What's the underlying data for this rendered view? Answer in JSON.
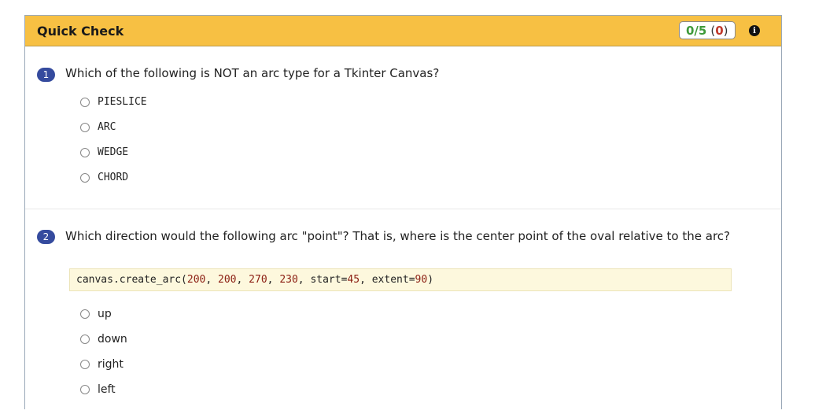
{
  "header": {
    "title": "Quick Check",
    "score": {
      "correct": "0/5",
      "open_paren": "(",
      "wrong": "0",
      "close_paren": ")"
    },
    "info_icon": "info-icon"
  },
  "questions": [
    {
      "number": "1",
      "text": "Which of the following is NOT an arc type for a Tkinter Canvas?",
      "options": [
        "PIESLICE",
        "ARC",
        "WEDGE",
        "CHORD"
      ]
    },
    {
      "number": "2",
      "text": "Which direction would the following arc \"point\"? That is, where is the center point of the oval relative to the arc?",
      "code": {
        "prefix": "canvas.create_arc(",
        "args": [
          "200",
          "200",
          "270",
          "230"
        ],
        "start_kw": "start=",
        "start": "45",
        "extent_kw": "extent=",
        "extent": "90",
        "suffix": ")"
      },
      "options": [
        "up",
        "down",
        "right",
        "left"
      ]
    }
  ],
  "colors": {
    "header_bg": "#f7c043",
    "badge_bg": "#354b9e",
    "correct": "#3e9a3a",
    "wrong": "#c0392b",
    "code_bg": "#fdf8dd",
    "code_number": "#8b1e12"
  }
}
